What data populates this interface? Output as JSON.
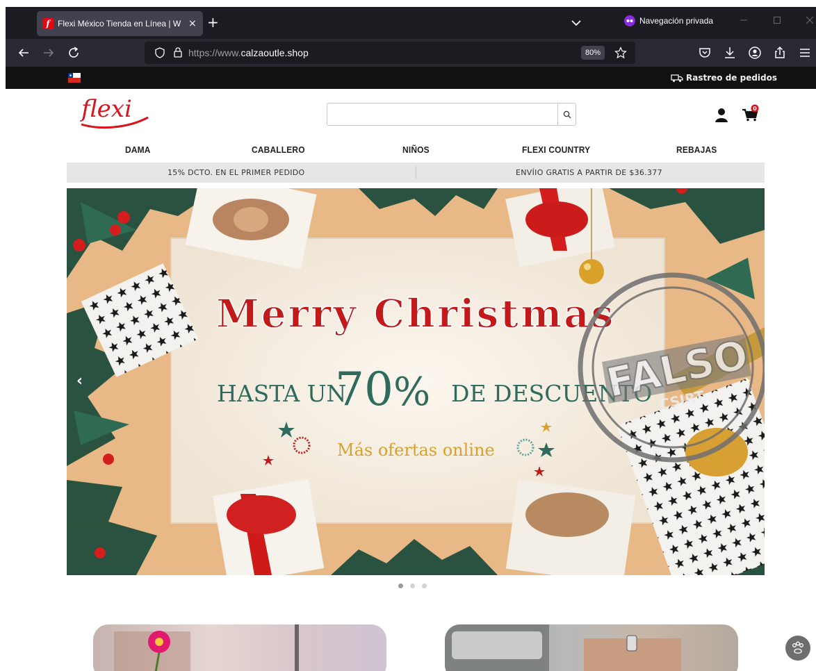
{
  "browser": {
    "tab_title": "Flexi México Tienda en Línea | W",
    "tab_close": "×",
    "new_tab": "+",
    "private_label": "Navegación privada",
    "url_prefix": "https://www.",
    "url_host": "calzaoutle.shop",
    "zoom": "80%"
  },
  "site": {
    "logo_text": "flexi",
    "tracking_label": "Rastreo de pedidos",
    "search_placeholder": "",
    "cart_count": "0",
    "nav": [
      "DAMA",
      "CABALLERO",
      "NIÑOS",
      "FLEXI COUNTRY",
      "REBAJAS"
    ],
    "promo_left": "15% DCTO. EN EL PRIMER PEDIDO",
    "promo_right": "ENVÍIO GRATIS A PARTIR DE $36.377"
  },
  "banner": {
    "headline": "Merry Christmas",
    "sub_pre": "HASTA UN",
    "sub_percent": "70",
    "sub_pct_sign": "%",
    "sub_post": "DE DESCUENTO",
    "offers": "Más ofertas online",
    "stamp_text": "FALSO",
    "stamp_sub": "CSIRT",
    "prev_arrow": "‹",
    "next_arrow": "›",
    "slides": 3,
    "active_slide": 1
  },
  "colors": {
    "brand_red": "#d9141c",
    "headline_red": "#c21a1a",
    "teal": "#2e6b5c",
    "gold": "#d9a02a",
    "chrome_dark": "#1c1b22",
    "chrome_mid": "#2b2a33"
  }
}
